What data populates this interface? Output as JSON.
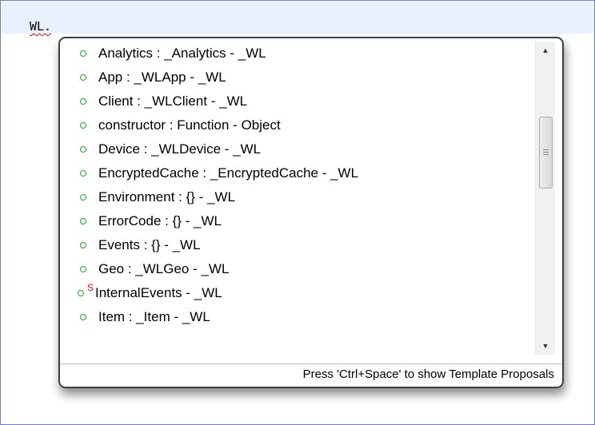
{
  "editor": {
    "code_text": "WL."
  },
  "proposals": {
    "items": [
      {
        "label": "Analytics : _Analytics - _WL",
        "icon": "green-circle-field-icon",
        "static": false
      },
      {
        "label": "App : _WLApp - _WL",
        "icon": "green-circle-field-icon",
        "static": false
      },
      {
        "label": "Client : _WLClient - _WL",
        "icon": "green-circle-field-icon",
        "static": false
      },
      {
        "label": "constructor : Function - Object",
        "icon": "green-circle-field-icon",
        "static": false
      },
      {
        "label": "Device : _WLDevice - _WL",
        "icon": "green-circle-field-icon",
        "static": false
      },
      {
        "label": "EncryptedCache : _EncryptedCache - _WL",
        "icon": "green-circle-field-icon",
        "static": false
      },
      {
        "label": "Environment : {} - _WL",
        "icon": "green-circle-field-icon",
        "static": false
      },
      {
        "label": "ErrorCode : {} - _WL",
        "icon": "green-circle-field-icon",
        "static": false
      },
      {
        "label": "Events : {} - _WL",
        "icon": "green-circle-field-icon",
        "static": false
      },
      {
        "label": "Geo : _WLGeo - _WL",
        "icon": "green-circle-field-icon",
        "static": false
      },
      {
        "label": "InternalEvents - _WL",
        "icon": "green-circle-static-field-icon",
        "static": true,
        "badge": "S"
      },
      {
        "label": "Item : _Item - _WL",
        "icon": "green-circle-field-icon",
        "static": false
      }
    ]
  },
  "scrollbar": {
    "up_arrow": "▲",
    "down_arrow": "▼"
  },
  "status": {
    "hint_text": "Press 'Ctrl+Space' to show Template Proposals"
  },
  "colors": {
    "field_icon": "#26a626",
    "static_badge": "#c21010",
    "editor_line_highlight": "#e8f0fb",
    "frame_border": "#6b7bd6"
  }
}
